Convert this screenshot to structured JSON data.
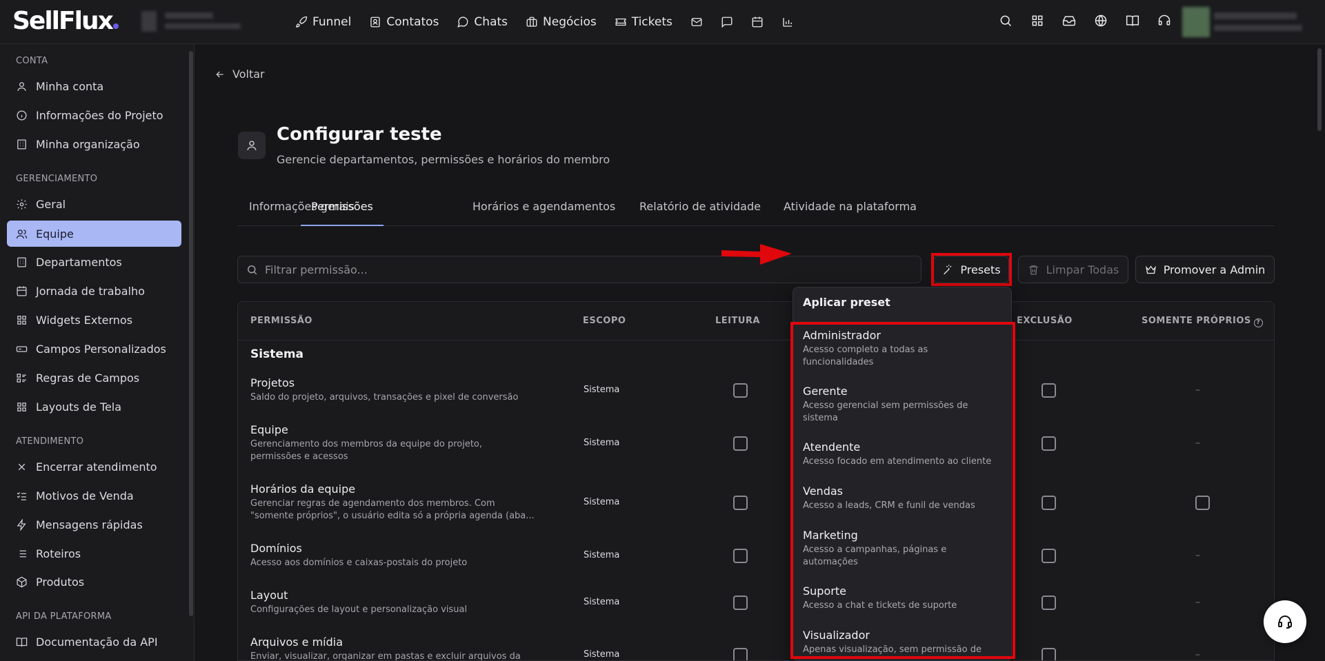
{
  "brand": {
    "logo": "SellFlux"
  },
  "topnav": {
    "items": [
      {
        "label": "Funnel",
        "icon": "rocket-icon"
      },
      {
        "label": "Contatos",
        "icon": "contact-icon"
      },
      {
        "label": "Chats",
        "icon": "chat-icon"
      },
      {
        "label": "Negócios",
        "icon": "briefcase-icon"
      },
      {
        "label": "Tickets",
        "icon": "ticket-icon"
      }
    ],
    "extra_icons": [
      "mail-icon",
      "message-square-icon",
      "calendar-icon",
      "bar-chart-icon"
    ],
    "right_icons": [
      "search-icon",
      "apps-icon",
      "inbox-icon",
      "globe-icon",
      "book-icon",
      "headset-icon"
    ]
  },
  "sidebar": {
    "sections": [
      {
        "title": "CONTA",
        "items": [
          "Minha conta",
          "Informações do Projeto",
          "Minha organização"
        ]
      },
      {
        "title": "GERENCIAMENTO",
        "items": [
          "Geral",
          "Equipe",
          "Departamentos",
          "Jornada de trabalho",
          "Widgets Externos",
          "Campos Personalizados",
          "Regras de Campos",
          "Layouts de Tela"
        ]
      },
      {
        "title": "ATENDIMENTO",
        "items": [
          "Encerrar atendimento",
          "Motivos de Venda",
          "Mensagens rápidas",
          "Roteiros",
          "Produtos"
        ]
      },
      {
        "title": "API DA PLATAFORMA",
        "items": [
          "Documentação da API"
        ]
      }
    ],
    "active": "Equipe"
  },
  "page": {
    "back_label": "Voltar",
    "title": "Configurar teste",
    "subtitle": "Gerencie departamentos, permissões e horários do membro",
    "tabs": [
      "Informações gerais",
      "Permissões",
      "Horários e agendamentos",
      "Relatório de atividade",
      "Atividade na plataforma"
    ],
    "active_tab": "Permissões"
  },
  "toolbar": {
    "filter_placeholder": "Filtrar permissão...",
    "presets_label": "Presets",
    "clear_label": "Limpar Todas",
    "promote_label": "Promover a Admin"
  },
  "table": {
    "headers": [
      "PERMISSÃO",
      "ESCOPO",
      "LEITURA",
      "EXCLUSÃO",
      "SOMENTE PRÓPRIOS"
    ],
    "group": "Sistema",
    "rows": [
      {
        "title": "Projetos",
        "desc": "Saldo do projeto, arquivos, transações e pixel de conversão",
        "scope": "Sistema",
        "own": "–"
      },
      {
        "title": "Equipe",
        "desc": "Gerenciamento dos membros da equipe do projeto, permissões e acessos",
        "scope": "Sistema",
        "own": "–"
      },
      {
        "title": "Horários da equipe",
        "desc": "Gerenciar regras de agendamento dos membros. Com \"somente próprios\", o usuário edita só a própria agenda (aba...",
        "scope": "Sistema",
        "own": "checkbox"
      },
      {
        "title": "Domínios",
        "desc": "Acesso aos domínios e caixas-postais do projeto",
        "scope": "Sistema",
        "own": "–"
      },
      {
        "title": "Layout",
        "desc": "Configurações de layout e personalização visual",
        "scope": "Sistema",
        "own": "–"
      },
      {
        "title": "Arquivos e mídia",
        "desc": "Enviar, visualizar, organizar em pastas e excluir arquivos da",
        "scope": "Sistema",
        "own": "–"
      }
    ]
  },
  "dropdown": {
    "heading": "Aplicar preset",
    "items": [
      {
        "name": "Administrador",
        "desc": "Acesso completo a todas as funcionalidades"
      },
      {
        "name": "Gerente",
        "desc": "Acesso gerencial sem permissões de sistema"
      },
      {
        "name": "Atendente",
        "desc": "Acesso focado em atendimento ao cliente"
      },
      {
        "name": "Vendas",
        "desc": "Acesso a leads, CRM e funil de vendas"
      },
      {
        "name": "Marketing",
        "desc": "Acesso a campanhas, páginas e automações"
      },
      {
        "name": "Suporte",
        "desc": "Acesso a chat e tickets de suporte"
      },
      {
        "name": "Visualizador",
        "desc": "Apenas visualização, sem permissão de"
      }
    ]
  },
  "colors": {
    "accent": "#a9b8f5",
    "highlight": "#e0070d",
    "background": "#161618"
  }
}
